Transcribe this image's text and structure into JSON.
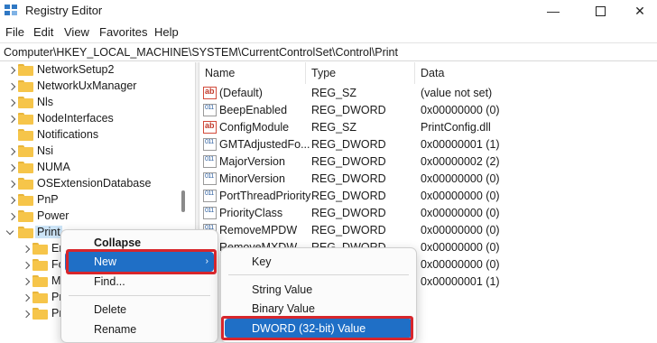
{
  "window": {
    "title": "Registry Editor",
    "minimize_glyph": "—",
    "close_glyph": "✕"
  },
  "menu": [
    "File",
    "Edit",
    "View",
    "Favorites",
    "Help"
  ],
  "address": "Computer\\HKEY_LOCAL_MACHINE\\SYSTEM\\CurrentControlSet\\Control\\Print",
  "tree": {
    "items": [
      {
        "label": "NetworkSetup2"
      },
      {
        "label": "NetworkUxManager"
      },
      {
        "label": "Nls"
      },
      {
        "label": "NodeInterfaces"
      },
      {
        "label": "Notifications"
      },
      {
        "label": "Nsi"
      },
      {
        "label": "NUMA"
      },
      {
        "label": "OSExtensionDatabase"
      },
      {
        "label": "PnP"
      },
      {
        "label": "Power"
      },
      {
        "label": "Print"
      },
      {
        "label": "En"
      },
      {
        "label": "Fo"
      },
      {
        "label": "M"
      },
      {
        "label": "Pr"
      },
      {
        "label": "Pr"
      }
    ]
  },
  "values": {
    "columns": [
      "Name",
      "Type",
      "Data"
    ],
    "rows": [
      {
        "name": "(Default)",
        "type": "REG_SZ",
        "data": "(value not set)",
        "icon": "string-value-icon"
      },
      {
        "name": "BeepEnabled",
        "type": "REG_DWORD",
        "data": "0x00000000 (0)",
        "icon": "dword-value-icon"
      },
      {
        "name": "ConfigModule",
        "type": "REG_SZ",
        "data": "PrintConfig.dll",
        "icon": "string-value-icon"
      },
      {
        "name": "GMTAdjustedFo...",
        "type": "REG_DWORD",
        "data": "0x00000001 (1)",
        "icon": "dword-value-icon"
      },
      {
        "name": "MajorVersion",
        "type": "REG_DWORD",
        "data": "0x00000002 (2)",
        "icon": "dword-value-icon"
      },
      {
        "name": "MinorVersion",
        "type": "REG_DWORD",
        "data": "0x00000000 (0)",
        "icon": "dword-value-icon"
      },
      {
        "name": "PortThreadPriority",
        "type": "REG_DWORD",
        "data": "0x00000000 (0)",
        "icon": "dword-value-icon"
      },
      {
        "name": "PriorityClass",
        "type": "REG_DWORD",
        "data": "0x00000000 (0)",
        "icon": "dword-value-icon"
      },
      {
        "name": "RemoveMPDW",
        "type": "REG_DWORD",
        "data": "0x00000000 (0)",
        "icon": "dword-value-icon"
      },
      {
        "name": "RemoveMXDW",
        "type": "REG_DWORD",
        "data": "0x00000000 (0)",
        "icon": "dword-value-icon"
      },
      {
        "name": "",
        "type": "",
        "data": "0x00000000 (0)",
        "icon": "dword-value-icon"
      },
      {
        "name": "",
        "type": "",
        "data": "0x00000001 (1)",
        "icon": "dword-value-icon"
      }
    ]
  },
  "context_menu": {
    "collapse": "Collapse",
    "new": "New",
    "find": "Find...",
    "delete": "Delete",
    "rename": "Rename",
    "arrow_glyph": "›"
  },
  "new_submenu": {
    "key": "Key",
    "string_value": "String Value",
    "binary_value": "Binary Value",
    "dword_value": "DWORD (32-bit) Value"
  },
  "colors": {
    "highlight": "#1f6fc6",
    "annotation": "#d7262c"
  }
}
